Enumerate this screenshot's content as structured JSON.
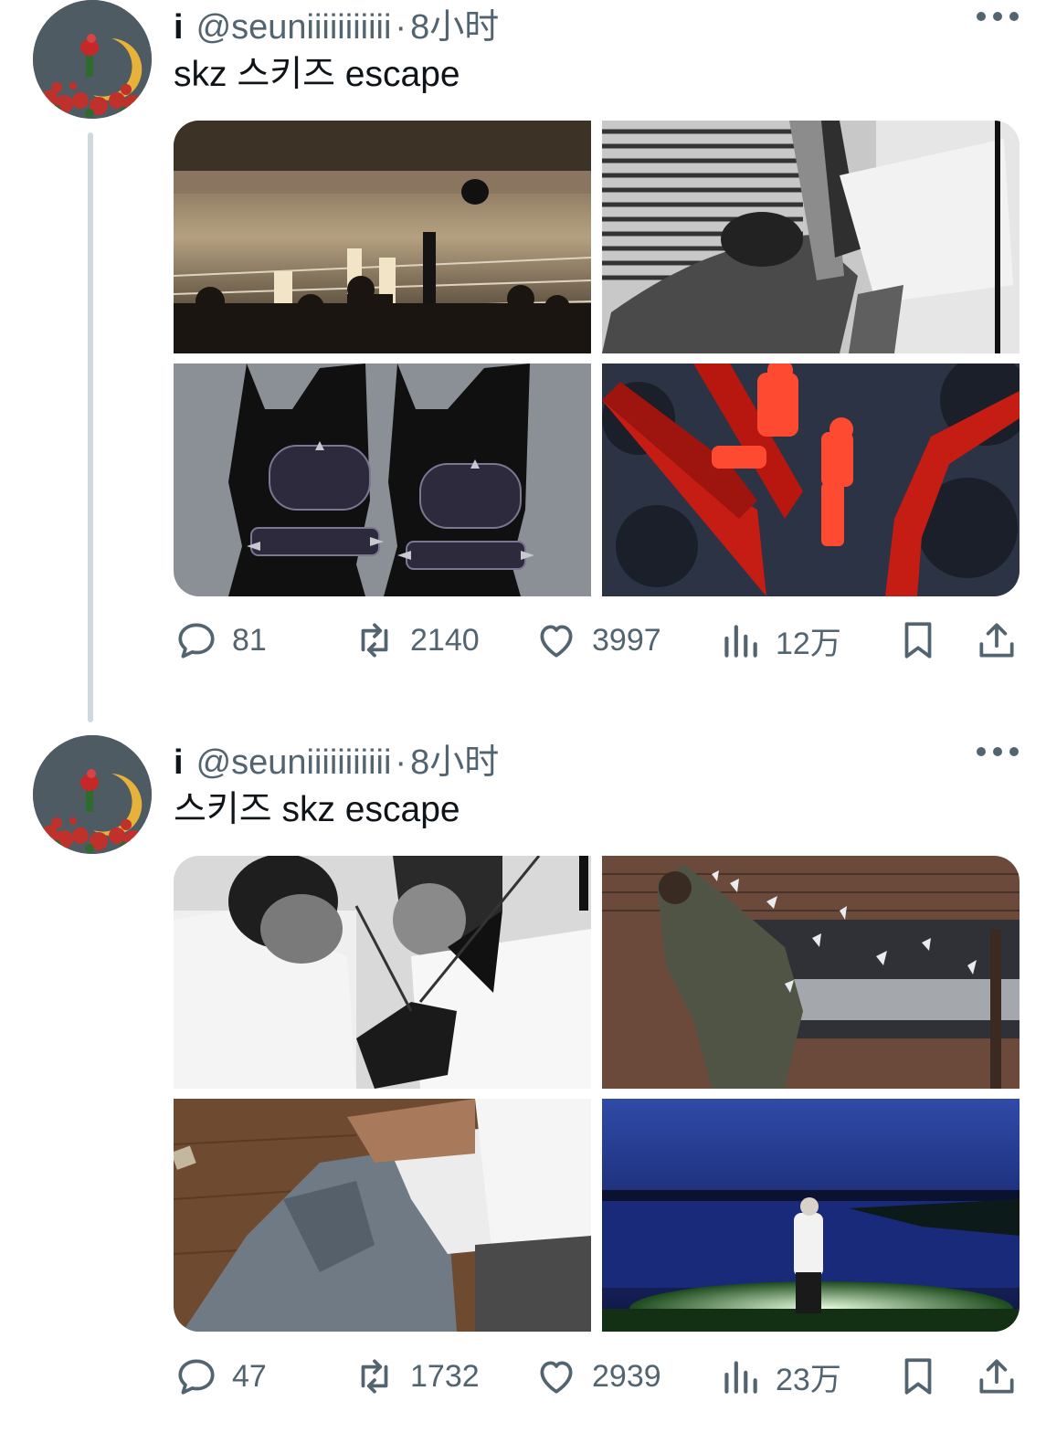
{
  "tweets": [
    {
      "display_name": "i",
      "handle": "@seuniiiiiiiiiii",
      "separator": "·",
      "time": "8小时",
      "text": "skz 스키즈 escape",
      "photos": [
        "boxing-ring-crowd",
        "man-arm-grab-bw",
        "dobermans-spiked-muzzles",
        "boys-in-red-tree"
      ],
      "stats": {
        "replies": "81",
        "retweets": "2140",
        "likes": "3997",
        "views": "12万"
      }
    },
    {
      "display_name": "i",
      "handle": "@seuniiiiiiiiiii",
      "separator": "·",
      "time": "8小时",
      "text": "스키즈 skz escape",
      "photos": [
        "fencing-duel-bw",
        "man-breaking-glass",
        "denim-jacket-floor",
        "figure-at-night-lake"
      ],
      "stats": {
        "replies": "47",
        "retweets": "1732",
        "likes": "2939",
        "views": "23万"
      }
    }
  ],
  "icons": {
    "reply": "comment-bubble-icon",
    "retweet": "retweet-arrows-icon",
    "like": "heart-icon",
    "views": "bar-chart-icon",
    "bookmark": "bookmark-icon",
    "share": "share-upload-icon",
    "more": "more-dots-icon"
  },
  "colors": {
    "muted": "#536471",
    "text": "#0f1419",
    "thread_line": "#cfd9de"
  }
}
